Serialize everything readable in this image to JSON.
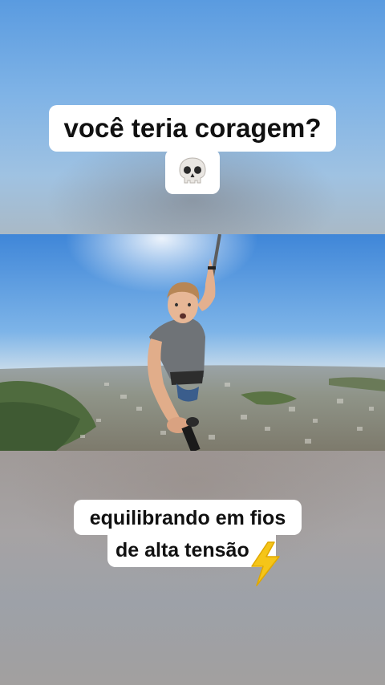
{
  "captions": {
    "top": "você teria coragem?",
    "top_emoji": "skull-emoji",
    "bottom_line1": "equilibrando em fios",
    "bottom_line2": "de alta tensão",
    "bottom_emoji": "lightning-emoji"
  },
  "colors": {
    "caption_bg": "#ffffff",
    "caption_text": "#111111",
    "sky": "#6fa8e6",
    "bolt": "#f5c518"
  }
}
